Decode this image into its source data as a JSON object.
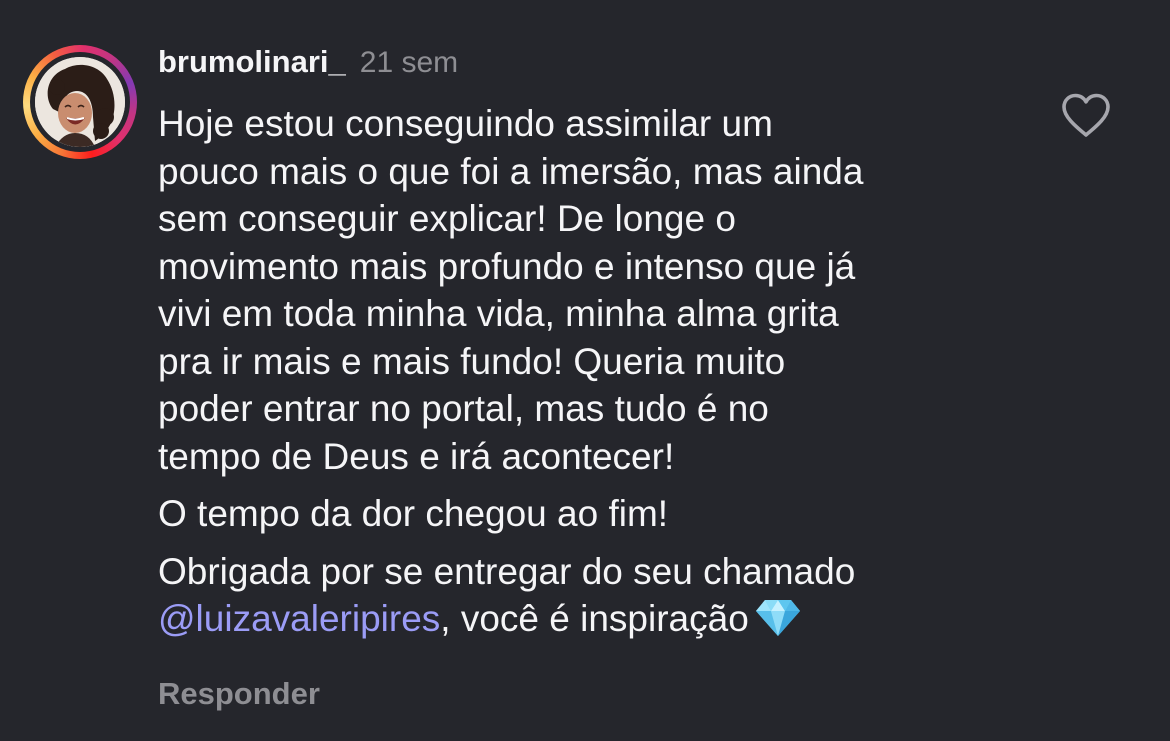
{
  "comment": {
    "username": "brumolinari_",
    "time": "21 sem",
    "paragraph1": [
      "Hoje estou conseguindo assimilar um",
      "pouco mais o que foi a imersão, mas ainda",
      "sem conseguir explicar! De longe o",
      "movimento mais profundo e intenso que já",
      "vivi em toda minha vida, minha alma grita",
      "pra ir mais e mais fundo! Queria muito",
      "poder entrar no portal, mas tudo é no",
      "tempo de Deus e irá acontecer!"
    ],
    "paragraph2": "O tempo da dor chegou ao fim!",
    "paragraph3_line1": "Obrigada por se entregar do seu chamado",
    "mention": "@luizavaleripires",
    "paragraph3_line2_rest": ", você é inspiração",
    "emoji": "gem-stone-emoji",
    "reply_label": "Responder"
  },
  "icons": {
    "like": "heart-outline-icon"
  },
  "colors": {
    "background": "#25262c",
    "text": "#f5f5f7",
    "muted": "#8e8e93",
    "mention": "#9b9cf6"
  }
}
